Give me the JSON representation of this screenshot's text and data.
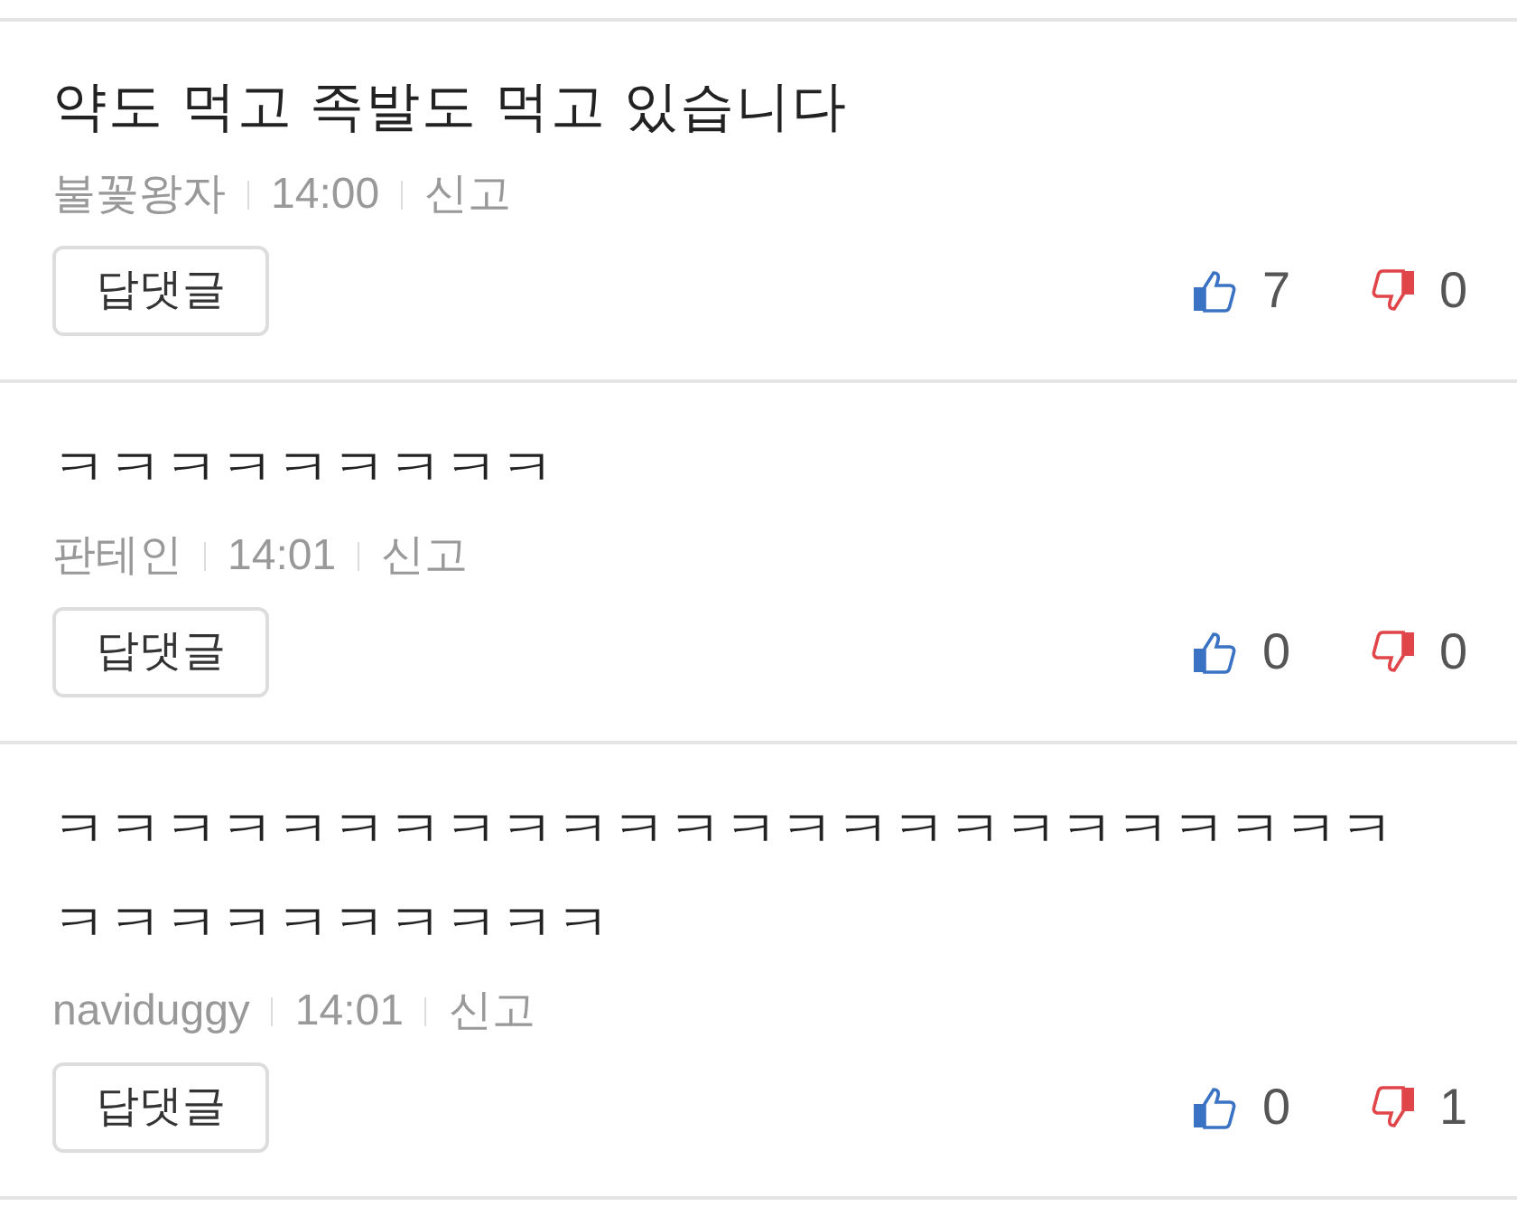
{
  "comments": [
    {
      "text": "약도 먹고 족발도 먹고 있습니다",
      "author": "불꽃왕자",
      "time": "14:00",
      "report": "신고",
      "reply_button": "답댓글",
      "likes": "7",
      "dislikes": "0"
    },
    {
      "text": "ㅋㅋㅋㅋㅋㅋㅋㅋㅋ",
      "author": "판테인",
      "time": "14:01",
      "report": "신고",
      "reply_button": "답댓글",
      "likes": "0",
      "dislikes": "0"
    },
    {
      "text": "ㅋㅋㅋㅋㅋㅋㅋㅋㅋㅋㅋㅋㅋㅋㅋㅋㅋㅋㅋㅋㅋㅋㅋㅋㅋㅋㅋㅋㅋㅋㅋㅋㅋㅋ",
      "author": "naviduggy",
      "time": "14:01",
      "report": "신고",
      "reply_button": "답댓글",
      "likes": "0",
      "dislikes": "1"
    }
  ]
}
